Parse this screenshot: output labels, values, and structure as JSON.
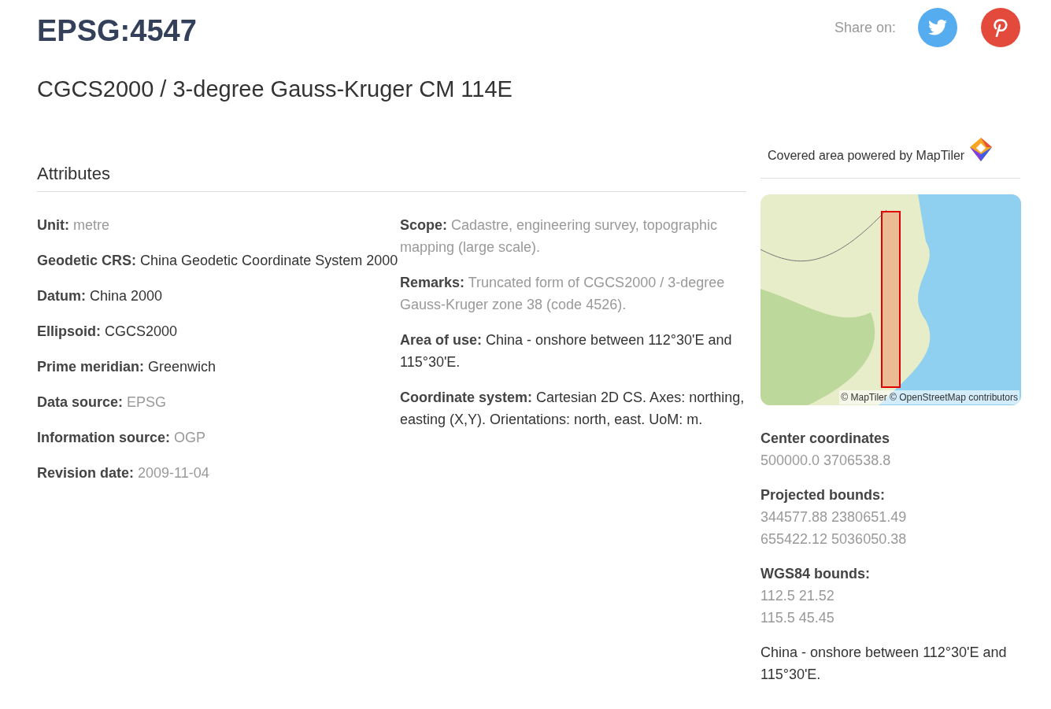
{
  "header": {
    "code": "EPSG:4547",
    "name": "CGCS2000 / 3-degree Gauss-Kruger CM 114E",
    "share_label": "Share on:",
    "share_buttons": [
      {
        "kind": "twitter"
      },
      {
        "kind": "pinterest"
      }
    ]
  },
  "attributes": {
    "title": "Attributes",
    "columns": [
      [
        {
          "label": "Unit:",
          "value": "metre",
          "muted": true
        },
        {
          "label": "Geodetic CRS:",
          "value": "China Geodetic Coordinate System 2000",
          "muted": false
        },
        {
          "label": "Datum:",
          "value": "China 2000",
          "muted": false
        },
        {
          "label": "Ellipsoid:",
          "value": "CGCS2000",
          "muted": false
        },
        {
          "label": "Prime meridian:",
          "value": "Greenwich",
          "muted": false
        },
        {
          "label": "Data source:",
          "value": "EPSG",
          "muted": true
        },
        {
          "label": "Information source:",
          "value": "OGP",
          "muted": true
        },
        {
          "label": "Revision date:",
          "value": "2009-11-04",
          "muted": true
        }
      ],
      [
        {
          "label": "Scope:",
          "value": "Cadastre, engineering survey, topographic mapping (large scale).",
          "muted": true
        },
        {
          "label": "Remarks:",
          "value": "Truncated form of CGCS2000 / 3-degree Gauss-Kruger zone 38 (code 4526).",
          "muted": true
        },
        {
          "label": "Area of use:",
          "value": "China - onshore between 112°30'E and 115°30'E.",
          "muted": false
        },
        {
          "label": "Coordinate system:",
          "value": "Cartesian 2D CS. Axes: northing, easting (X,Y). Orientations: north, east. UoM: m.",
          "muted": false
        }
      ]
    ]
  },
  "sidebar": {
    "map_title": "Covered area powered by MapTiler",
    "map_attribution": "© MapTiler © OpenStreetMap contributors",
    "sections": [
      {
        "heading": "Center coordinates",
        "lines": [
          "500000.0 3706538.8"
        ]
      },
      {
        "heading": "Projected bounds:",
        "lines": [
          "344577.88 2380651.49",
          "655422.12 5036050.38"
        ]
      },
      {
        "heading": "WGS84 bounds:",
        "lines": [
          "112.5 21.52",
          "115.5 45.45"
        ]
      }
    ],
    "area_text": "China - onshore between 112°30'E and 115°30'E."
  }
}
